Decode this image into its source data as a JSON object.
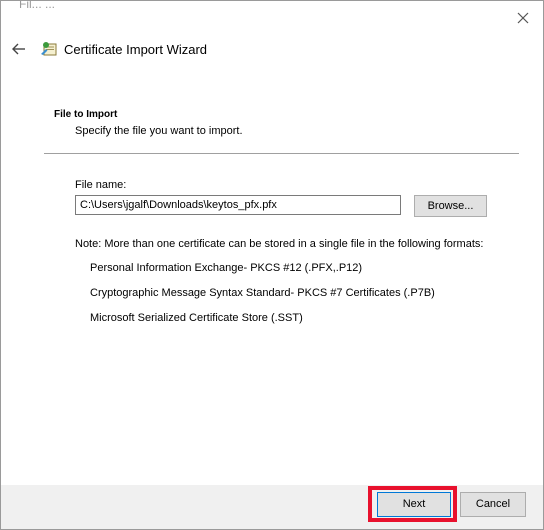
{
  "window": {
    "title_fragment": "Fil... ...",
    "close_icon": "close-icon"
  },
  "header": {
    "back_icon": "back-arrow-icon",
    "wizard_icon": "certificate-icon",
    "title": "Certificate Import Wizard"
  },
  "section": {
    "title": "File to Import",
    "subtitle": "Specify the file you want to import."
  },
  "file": {
    "label": "File name:",
    "value": "C:\\Users\\jgalf\\Downloads\\keytos_pfx.pfx",
    "browse_label": "Browse..."
  },
  "note": "Note:  More than one certificate can be stored in a single file in the following formats:",
  "formats": [
    "Personal Information Exchange- PKCS #12 (.PFX,.P12)",
    "Cryptographic Message Syntax Standard- PKCS #7 Certificates (.P7B)",
    "Microsoft Serialized Certificate Store (.SST)"
  ],
  "footer": {
    "next_label": "Next",
    "cancel_label": "Cancel",
    "highlight_color": "#e8112d"
  }
}
